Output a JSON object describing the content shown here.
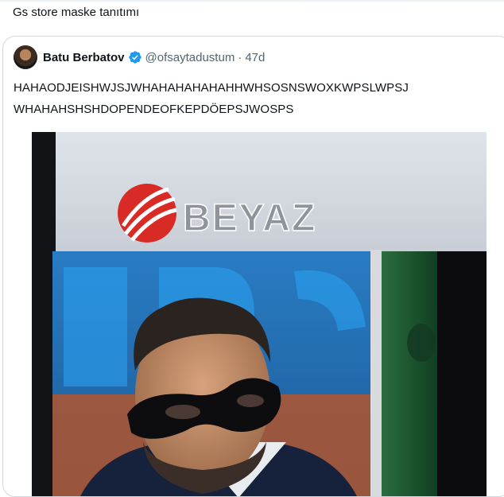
{
  "tweet": {
    "text": "Gs store maske tanıtımı"
  },
  "quote": {
    "author_name": "Batu Berbatov",
    "handle": "@ofsaytadustum",
    "separator": "·",
    "age": "47d",
    "text": "HAHAODJEISHWJSJWHAHAHAHAHAHHWHSOSNSWOXKWPSLWPSJ\nWHAHAHSHSHDOPENDEOFKEPDÖEPSJWOSPS"
  },
  "media": {
    "logo_text": "BEYAZ",
    "channel_logo_icon": "beyaz-tv-logo",
    "subject": "man-with-black-eye-mask"
  },
  "icons": {
    "verified": "verified-badge-icon"
  },
  "colors": {
    "verified_blue": "#1d9bf0",
    "border": "#cfd9de",
    "secondary_text": "#536471",
    "primary_text": "#0f1419"
  }
}
